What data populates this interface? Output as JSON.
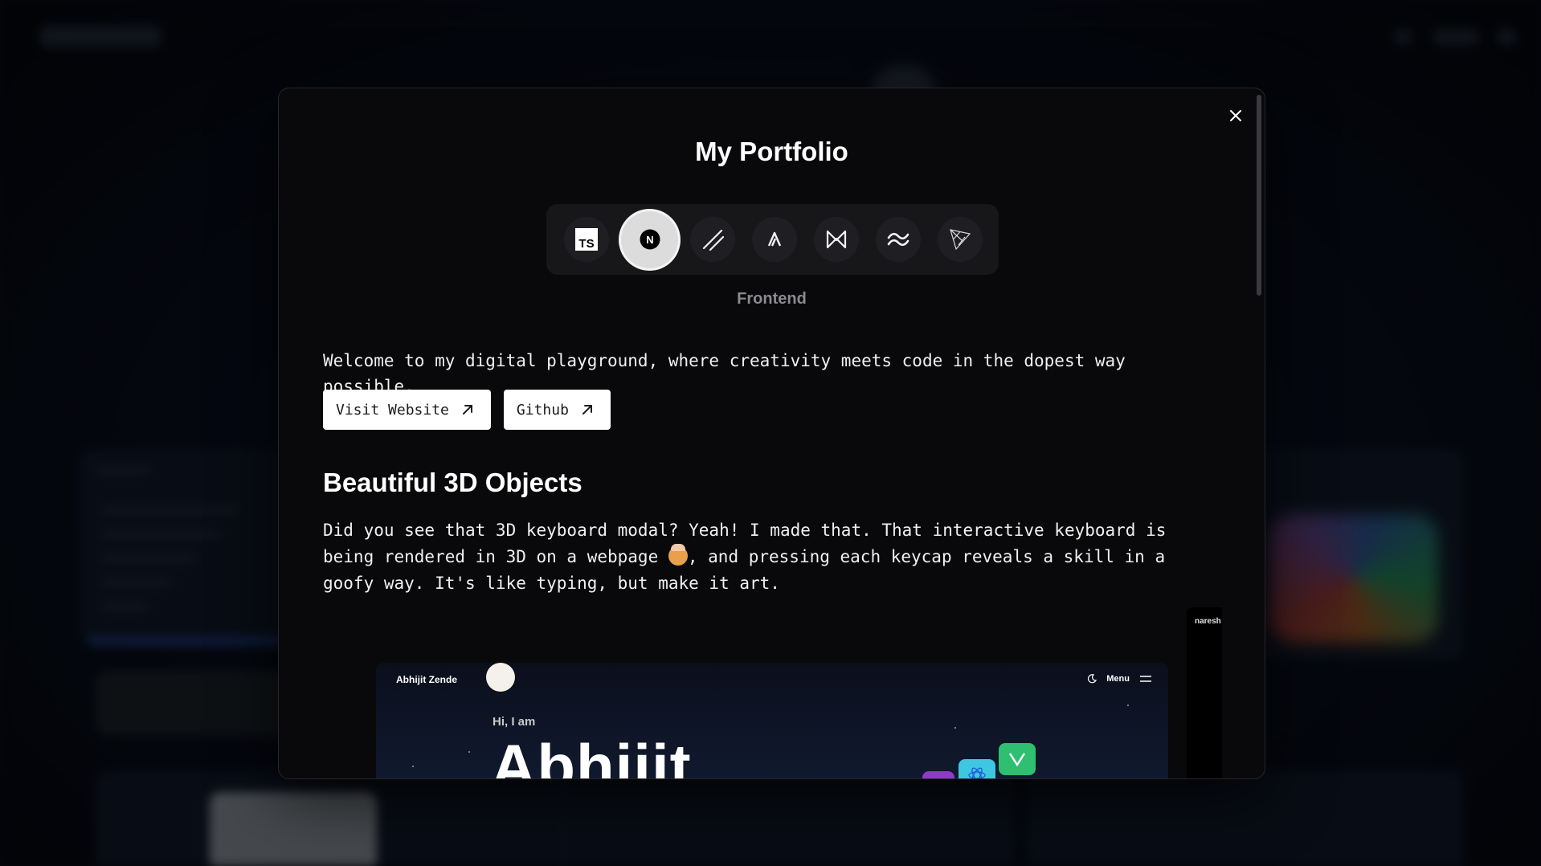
{
  "modal": {
    "title": "My Portfolio",
    "close_icon": "close-icon",
    "tech_stack": [
      {
        "name": "typescript-icon",
        "glyph": "TS"
      },
      {
        "name": "nextjs-icon",
        "glyph": "N"
      },
      {
        "name": "shadcn-icon"
      },
      {
        "name": "aceternity-icon"
      },
      {
        "name": "framer-motion-icon"
      },
      {
        "name": "tailwind-icon"
      },
      {
        "name": "threejs-icon"
      }
    ],
    "tech_category": "Frontend",
    "intro": "Welcome to my digital playground, where creativity meets code in the dopest way possible.",
    "buttons": {
      "visit_website": "Visit Website",
      "github": "Github",
      "arrow_icon": "arrow-up-right-icon"
    },
    "section": {
      "title": "Beautiful 3D Objects",
      "body_part1": "Did you see that 3D keyboard modal? Yeah! I made that. That interactive keyboard is being rendered in 3D on a webpage ",
      "emoji_icon": "exploding-head-emoji-icon",
      "body_part2": ", and pressing each keycap reveals a skill in a goofy way. It's like typing, but make it art."
    },
    "preview": {
      "brand": "Abhijit Zende",
      "menu_label": "Menu",
      "greeting": "Hi, I am",
      "name": "Abhijit",
      "side_label": "naresh"
    }
  },
  "colors": {
    "modal_bg": "#09090b",
    "button_bg": "#ffffff",
    "muted_text": "#8b8b8f"
  }
}
